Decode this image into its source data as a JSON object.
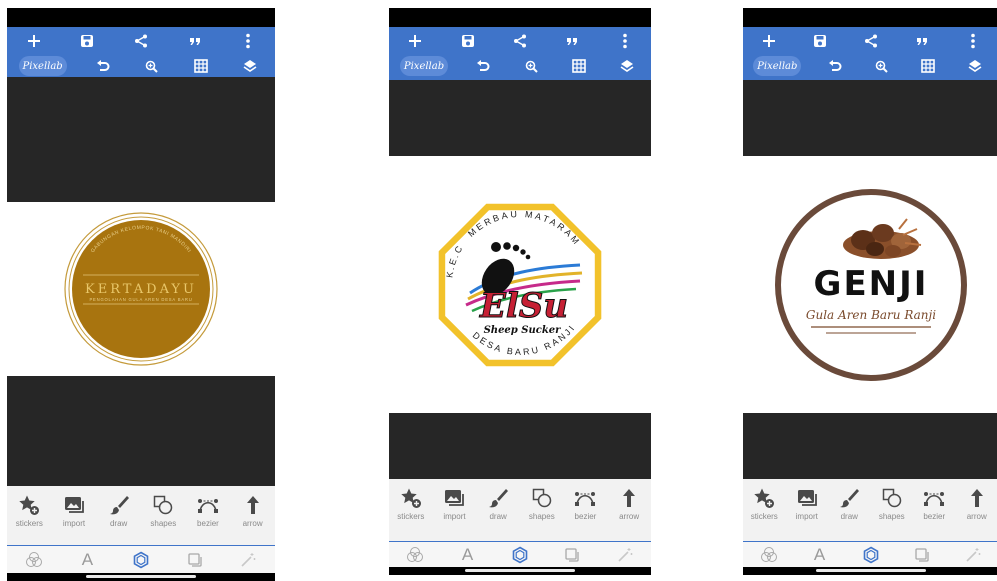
{
  "app": {
    "brand": "Pixellab"
  },
  "toolbar": {
    "row1": [
      "plus-icon",
      "save-icon",
      "share-icon",
      "quote-icon",
      "more-vert-icon"
    ],
    "row2": [
      "brand",
      "undo-icon",
      "zoom-icon",
      "grid-icon",
      "layers-icon"
    ]
  },
  "tools": [
    {
      "label": "stickers",
      "icon": "star-plus-icon"
    },
    {
      "label": "import",
      "icon": "image-import-icon"
    },
    {
      "label": "draw",
      "icon": "brush-icon"
    },
    {
      "label": "shapes",
      "icon": "shapes-icon"
    },
    {
      "label": "bezier",
      "icon": "bezier-icon"
    },
    {
      "label": "arrow",
      "icon": "arrow-up-icon"
    }
  ],
  "tabs": [
    "blend-icon",
    "text-A-icon",
    "shape-tab-icon",
    "duplicate-icon",
    "magic-wand-icon"
  ],
  "colors": {
    "toolbar": "#3f74c9",
    "canvas": "#262626"
  },
  "phones": [
    {
      "logo": {
        "kind": "kertadayu",
        "title": "KERTADAYU",
        "arc_text": "GABUNGAN KELOMPOK TANI MANDIRI",
        "sub_text": "PENGOLAHAN GULA AREN DESA BARU",
        "fill": "#a8740f",
        "title_color": "#e9c76a"
      }
    },
    {
      "logo": {
        "kind": "elsu",
        "top_text": "MERBAU MATARAM",
        "left_text": "K.E.C",
        "bottom_text": "DESA BARU RANJI",
        "title": "ElSu",
        "script_text": "Sheep Sucker",
        "border": "#f2c22b",
        "accent": "#c62034"
      }
    },
    {
      "logo": {
        "kind": "genji",
        "title": "GENJI",
        "subtitle": "Gula Aren Baru Ranji",
        "ring": "#6a4a3a",
        "accent": "#7a4a2c"
      }
    }
  ]
}
